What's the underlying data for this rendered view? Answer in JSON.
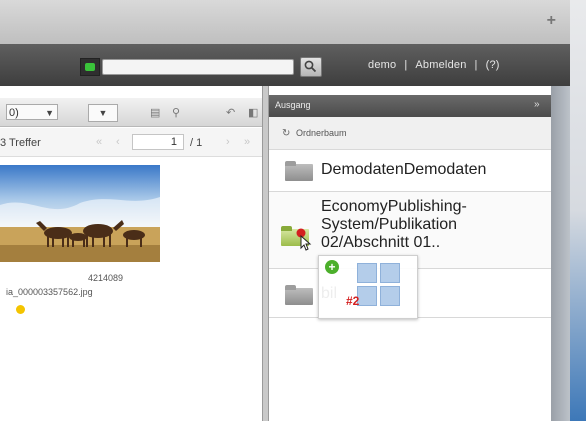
{
  "titlebar": {
    "add_label": "+"
  },
  "header": {
    "search": {
      "value": "",
      "placeholder": ""
    },
    "user": "demo",
    "separator": "|",
    "logout": "Abmelden",
    "help": "(?)"
  },
  "left": {
    "view_select": "0)",
    "hits": "3 Treffer",
    "page_current": "1",
    "page_total": "/ 1",
    "image": {
      "id": "4214089",
      "filename": "ia_000003357562.jpg"
    }
  },
  "right": {
    "panel_title": "Ausgang",
    "collapse_icon": "»",
    "tree_label": "Ordnerbaum",
    "rows": [
      {
        "label": "DemodatenDemodaten"
      },
      {
        "label_lines": [
          "EconomyPublishing-",
          "System/Publikation",
          "02/Abschnitt 01.."
        ]
      },
      {
        "label": "bil"
      }
    ]
  },
  "drag": {
    "plus": "+",
    "count": "#2"
  },
  "icons": [
    "status-online-icon",
    "search-icon",
    "chevron-down-icon",
    "refresh-icon",
    "folder-icon",
    "add-badge-icon",
    "drag-cursor-icon"
  ],
  "colors": {
    "status_green": "#3ac33a",
    "badge_green": "#4caf2b",
    "count_red": "#d42020",
    "status_yellow": "#f4c400"
  }
}
